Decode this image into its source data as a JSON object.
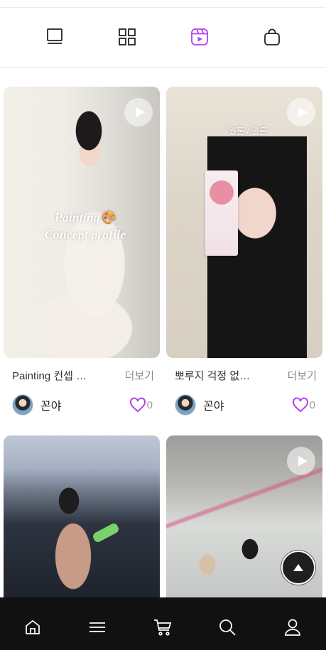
{
  "tabs": [
    {
      "name": "feed-tab",
      "icon": "feed-view-icon",
      "active": false
    },
    {
      "name": "grid-tab",
      "icon": "grid-view-icon",
      "active": false
    },
    {
      "name": "video-tab",
      "icon": "video-reel-icon",
      "active": true
    },
    {
      "name": "shop-tab",
      "icon": "shopping-bag-icon",
      "active": false
    }
  ],
  "colors": {
    "accent": "#b43ff5",
    "icon": "#222222",
    "nav_bg": "#111111"
  },
  "posts": [
    {
      "overlay_line1": "Painting🎨",
      "overlay_line2": "Concept profile",
      "caption": "Painting 컨셉 …",
      "more_label": "더보기",
      "author": "꼰야",
      "likes": "0",
      "play_icon": "play-icon"
    },
    {
      "overlay_tag": "웜톤 / 쿨톤",
      "caption": "뽀루지 걱정 없…",
      "more_label": "더보기",
      "author": "꼰야",
      "likes": "0",
      "play_icon": "play-icon"
    },
    {
      "play_icon": "none"
    },
    {
      "play_icon": "play-icon"
    }
  ],
  "bottom_nav": [
    {
      "name": "home",
      "icon": "home-icon"
    },
    {
      "name": "menu",
      "icon": "menu-icon"
    },
    {
      "name": "cart",
      "icon": "cart-icon"
    },
    {
      "name": "search",
      "icon": "search-icon"
    },
    {
      "name": "profile",
      "icon": "user-icon"
    }
  ],
  "scroll_top_icon": "arrow-up-icon"
}
